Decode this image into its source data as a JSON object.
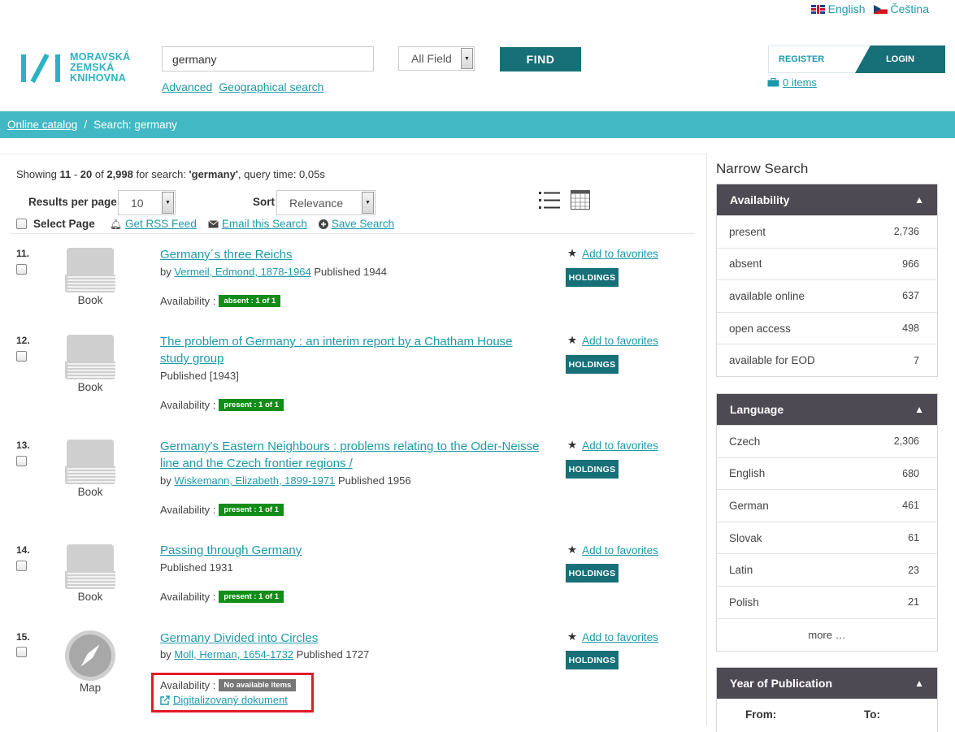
{
  "header": {
    "lang_en": "English",
    "lang_cs": "Čeština",
    "logo_lines": [
      "MORAVSKÁ",
      "ZEMSKÁ",
      "KNIHOVNA"
    ],
    "search_value": "germany",
    "field_select": "All Field",
    "find_label": "FIND",
    "advanced_label": "Advanced",
    "geo_label": "Geographical search",
    "register_label": "REGISTER",
    "login_label": "LOGIN",
    "cart_label": "0 items"
  },
  "breadcrumb": {
    "home": "Online catalog",
    "separator": "/",
    "current": "Search: germany"
  },
  "results": {
    "showing_prefix": "Showing ",
    "range_start": "11",
    "range_sep": " - ",
    "range_end": "20",
    "of": " of ",
    "total": "2,998",
    "for_search": " for search: ",
    "query": "'germany'",
    "query_time": ", query time: 0,05s",
    "per_page_label": "Results per page",
    "per_page_value": "10",
    "sort_label": "Sort",
    "sort_value": "Relevance",
    "select_page": "Select Page",
    "rss": "Get RSS Feed",
    "email": "Email this Search",
    "save": "Save Search",
    "availability_label": "Availability :",
    "fav_label": "Add to favorites",
    "holdings_label": "HOLDINGS",
    "records": [
      {
        "num": "11.",
        "format": "Book",
        "title": "Germany´s three Reichs",
        "by": "by ",
        "author": "Vermeil, Edmond, 1878-1964",
        "published": " Published 1944",
        "status": "absent : 1 of 1"
      },
      {
        "num": "12.",
        "format": "Book",
        "title": "The problem of Germany : an interim report by a Chatham House study group",
        "published": "Published [1943]",
        "status": "present : 1 of 1"
      },
      {
        "num": "13.",
        "format": "Book",
        "title": "Germany's Eastern Neighbours : problems relating to the Oder-Neisse line and the Czech frontier regions /",
        "by": "by ",
        "author": "Wiskemann, Elizabeth, 1899-1971",
        "published": " Published 1956",
        "status": "present : 1 of 1"
      },
      {
        "num": "14.",
        "format": "Book",
        "title": "Passing through Germany",
        "published": "Published 1931",
        "status": "present : 1 of 1"
      },
      {
        "num": "15.",
        "format": "Map",
        "title": "Germany Divided into Circles",
        "by": "by ",
        "author": "Moll, Herman, 1654-1732",
        "published": " Published 1727",
        "status": "No available items",
        "digital": "Digitalizovaný dokument"
      }
    ]
  },
  "sidebar": {
    "title": "Narrow Search",
    "availability": {
      "title": "Availability",
      "items": [
        {
          "label": "present",
          "count": "2,736"
        },
        {
          "label": "absent",
          "count": "966"
        },
        {
          "label": "available online",
          "count": "637"
        },
        {
          "label": "open access",
          "count": "498"
        },
        {
          "label": "available for EOD",
          "count": "7"
        }
      ]
    },
    "language": {
      "title": "Language",
      "items": [
        {
          "label": "Czech",
          "count": "2,306"
        },
        {
          "label": "English",
          "count": "680"
        },
        {
          "label": "German",
          "count": "461"
        },
        {
          "label": "Slovak",
          "count": "61"
        },
        {
          "label": "Latin",
          "count": "23"
        },
        {
          "label": "Polish",
          "count": "21"
        }
      ],
      "more": "more …"
    },
    "year": {
      "title": "Year of Publication",
      "from": "From:",
      "to": "To:"
    }
  },
  "colors": {
    "accent": "#1d9aa8",
    "dark_teal": "#176f78",
    "breadcrumb_bg": "#41b8c4",
    "facet_head": "#4d4a53",
    "badge_green": "#138c1a",
    "highlight": "#e01b2a"
  }
}
